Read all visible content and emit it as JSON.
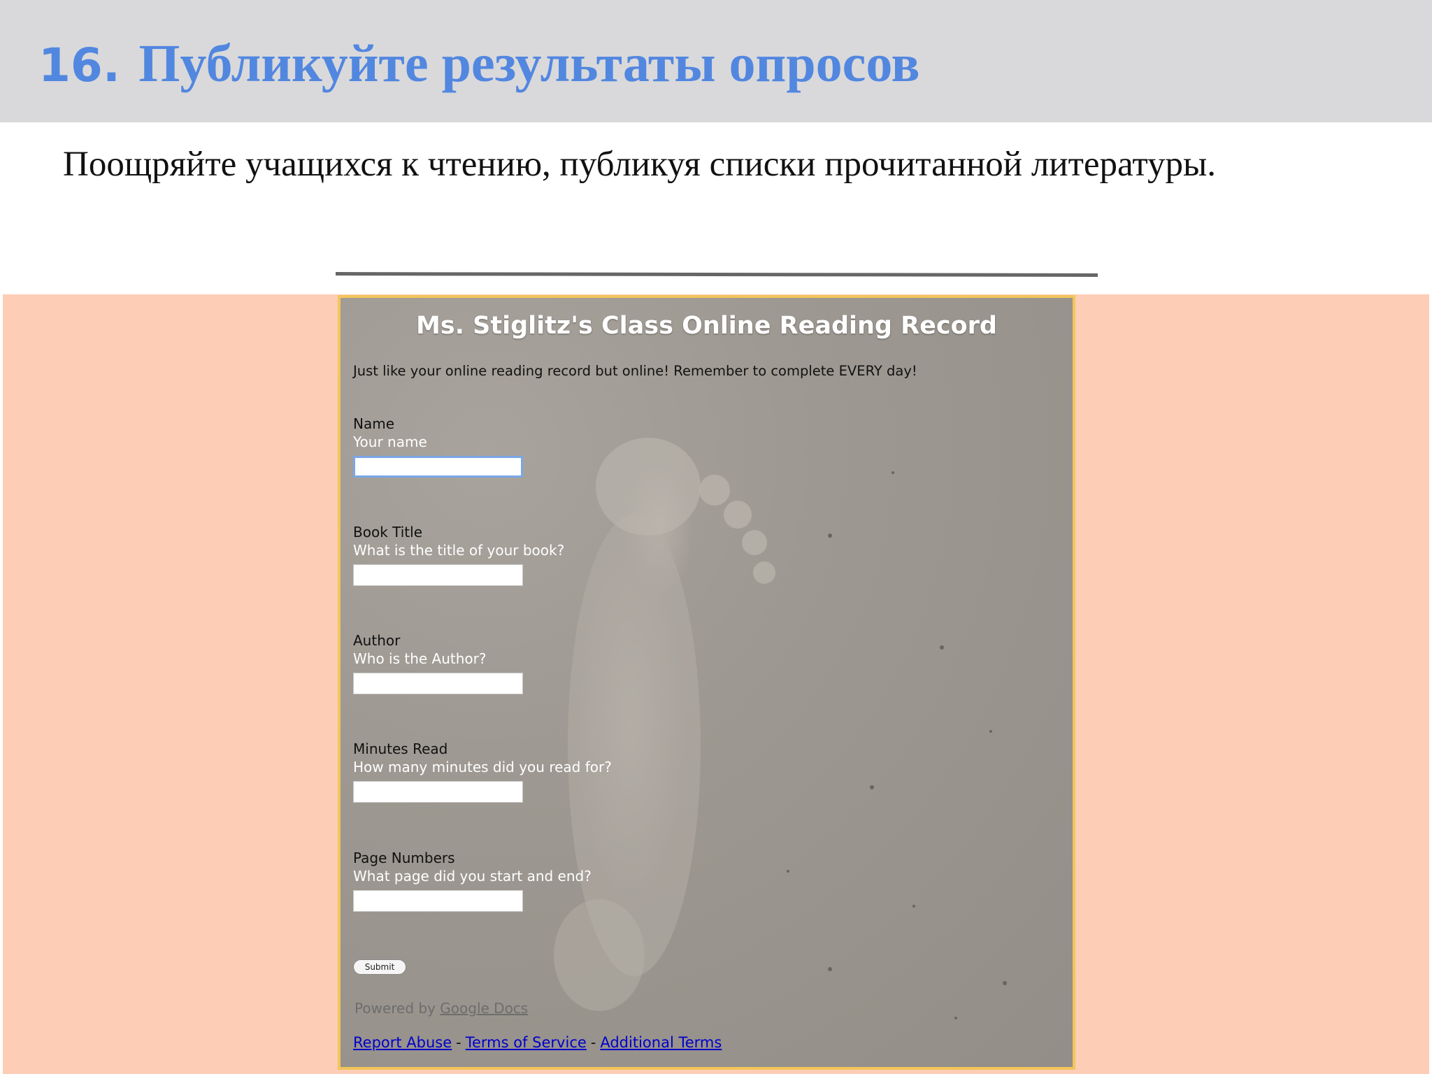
{
  "slide": {
    "number": "16.",
    "title": "Публикуйте результаты опросов",
    "subtitle": "Поощряйте учащихся к чтению, публикуя списки прочитанной литературы."
  },
  "form": {
    "title": "Ms. Stiglitz's Class Online Reading Record",
    "description": "Just like your online reading record but online!  Remember to complete EVERY day!",
    "fields": [
      {
        "label": "Name",
        "help": "Your name",
        "value": ""
      },
      {
        "label": "Book Title",
        "help": "What is the title of your book?",
        "value": ""
      },
      {
        "label": "Author",
        "help": "Who is the Author?",
        "value": ""
      },
      {
        "label": "Minutes Read",
        "help": "How many minutes did you read for?",
        "value": ""
      },
      {
        "label": "Page Numbers",
        "help": "What page did you start and end?",
        "value": ""
      }
    ],
    "submit_label": "Submit",
    "powered_by": "Powered by",
    "powered_link": "Google Docs",
    "footer": {
      "report_abuse": "Report Abuse",
      "sep1": "-",
      "terms": "Terms of Service",
      "sep2": "-",
      "additional": "Additional Terms"
    }
  },
  "colors": {
    "title_blue": "#5287e0",
    "title_bar": "#d9d9db",
    "peach_background": "#fdcdb6",
    "form_border": "#f3c55a",
    "link_blue": "#0000cc"
  }
}
